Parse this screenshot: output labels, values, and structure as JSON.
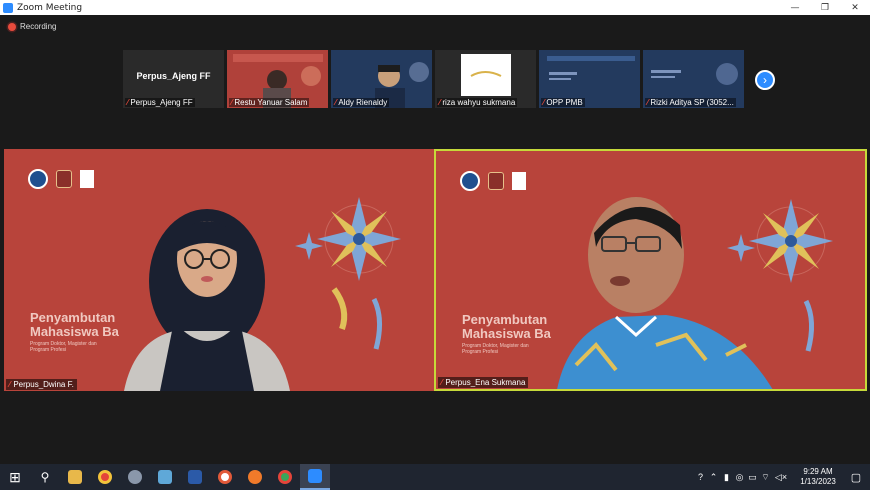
{
  "window": {
    "title": "Zoom Meeting",
    "minimize_glyph": "—",
    "maximize_glyph": "❐",
    "close_glyph": "✕"
  },
  "recording": {
    "label": "Recording"
  },
  "thumbnails": [
    {
      "name": "Perpus_Ajeng FF",
      "display_name": "Perpus_Ajeng FF",
      "muted": true
    },
    {
      "name": "Restu Yanuar Salam",
      "muted": true
    },
    {
      "name": "Aldy Rienaldy",
      "muted": true
    },
    {
      "name": "riza wahyu sukmana",
      "muted": true
    },
    {
      "name": "OPP PMB",
      "muted": true
    },
    {
      "name": "Rizki Aditya SP (3052...",
      "muted": true
    }
  ],
  "next_page_glyph": "›",
  "tiles": [
    {
      "name": "Perpus_Dwina F.",
      "welcome": "Penyambutan Mahasiswa Ba",
      "sub": "Program Doktor, Magister dan Program Profesi"
    },
    {
      "name": "Perpus_Ena Sukmana",
      "welcome": "Penyambutan Mahasiswa Ba",
      "sub": "Program Doktor, Magister dan Program Profesi"
    }
  ],
  "taskbar": {
    "start_glyph": "⊞",
    "search_glyph": "⚲",
    "apps": [
      "file-explorer",
      "chrome",
      "app-grey",
      "app-blue",
      "word",
      "app-circle",
      "firefox",
      "chrome-2",
      "zoom"
    ]
  },
  "tray": {
    "glyphs": [
      "?",
      "⌃",
      "▮",
      "◎",
      "▭",
      "⌔",
      "◁×"
    ],
    "time": "9:29 AM",
    "date": "1/13/2023",
    "notification_glyph": "▢"
  },
  "colors": {
    "accent": "#2d8cff",
    "backdrop_red": "#b8443b",
    "active_speaker": "#c6d93a",
    "mute_red": "#e84b3c"
  }
}
